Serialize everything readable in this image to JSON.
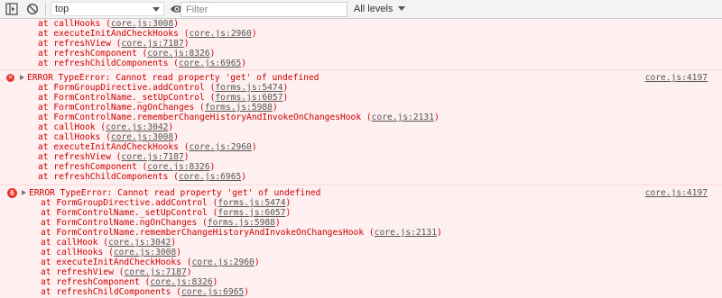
{
  "toolbar": {
    "context": "top",
    "filter_placeholder": "Filter",
    "levels_label": "All levels"
  },
  "colors": {
    "error_text": "#c00",
    "error_bg": "#fef0f0",
    "error_icon": "#e8352f"
  },
  "messages": [
    {
      "frames": [
        {
          "fn": "at callHooks (",
          "loc": "core.js:3008",
          "tail": ")"
        },
        {
          "fn": "at executeInitAndCheckHooks (",
          "loc": "core.js:2960",
          "tail": ")"
        },
        {
          "fn": "at refreshView (",
          "loc": "core.js:7187",
          "tail": ")"
        },
        {
          "fn": "at refreshComponent (",
          "loc": "core.js:8326",
          "tail": ")"
        },
        {
          "fn": "at refreshChildComponents (",
          "loc": "core.js:6965",
          "tail": ")"
        }
      ]
    },
    {
      "header": "ERROR TypeError: Cannot read property 'get' of undefined",
      "source": "core.js:4197",
      "frames": [
        {
          "fn": "at FormGroupDirective.addControl (",
          "loc": "forms.js:5474",
          "tail": ")"
        },
        {
          "fn": "at FormControlName._setUpControl (",
          "loc": "forms.js:6057",
          "tail": ")"
        },
        {
          "fn": "at FormControlName.ngOnChanges (",
          "loc": "forms.js:5988",
          "tail": ")"
        },
        {
          "fn": "at FormControlName.rememberChangeHistoryAndInvokeOnChangesHook (",
          "loc": "core.js:2131",
          "tail": ")"
        },
        {
          "fn": "at callHook (",
          "loc": "core.js:3042",
          "tail": ")"
        },
        {
          "fn": "at callHooks (",
          "loc": "core.js:3008",
          "tail": ")"
        },
        {
          "fn": "at executeInitAndCheckHooks (",
          "loc": "core.js:2960",
          "tail": ")"
        },
        {
          "fn": "at refreshView (",
          "loc": "core.js:7187",
          "tail": ")"
        },
        {
          "fn": "at refreshComponent (",
          "loc": "core.js:8326",
          "tail": ")"
        },
        {
          "fn": "at refreshChildComponents (",
          "loc": "core.js:6965",
          "tail": ")"
        }
      ]
    },
    {
      "count": "6",
      "header": "ERROR TypeError: Cannot read property 'get' of undefined",
      "source": "core.js:4197",
      "frames": [
        {
          "fn": "at FormGroupDirective.addControl (",
          "loc": "forms.js:5474",
          "tail": ")"
        },
        {
          "fn": "at FormControlName._setUpControl (",
          "loc": "forms.js:6057",
          "tail": ")"
        },
        {
          "fn": "at FormControlName.ngOnChanges (",
          "loc": "forms.js:5988",
          "tail": ")"
        },
        {
          "fn": "at FormControlName.rememberChangeHistoryAndInvokeOnChangesHook (",
          "loc": "core.js:2131",
          "tail": ")"
        },
        {
          "fn": "at callHook (",
          "loc": "core.js:3042",
          "tail": ")"
        },
        {
          "fn": "at callHooks (",
          "loc": "core.js:3008",
          "tail": ")"
        },
        {
          "fn": "at executeInitAndCheckHooks (",
          "loc": "core.js:2960",
          "tail": ")"
        },
        {
          "fn": "at refreshView (",
          "loc": "core.js:7187",
          "tail": ")"
        },
        {
          "fn": "at refreshComponent (",
          "loc": "core.js:8326",
          "tail": ")"
        },
        {
          "fn": "at refreshChildComponents (",
          "loc": "core.js:6965",
          "tail": ")"
        }
      ]
    }
  ]
}
